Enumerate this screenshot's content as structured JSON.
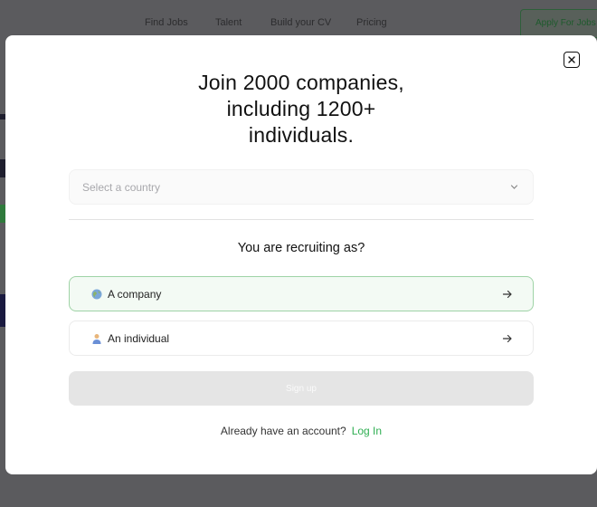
{
  "background_nav": {
    "links": [
      "Find Jobs",
      "Talent",
      "Build your CV",
      "Pricing"
    ],
    "apply_label": "Apply For Jobs"
  },
  "modal": {
    "headline": [
      "Join 2000 companies,",
      "including 1200+",
      "individuals."
    ],
    "country_select": {
      "placeholder": "Select a country",
      "icon": "chevron-down-icon"
    },
    "question": "You are recruiting as?",
    "options": [
      {
        "label": "A company",
        "icon": "globe-icon"
      },
      {
        "label": "An individual",
        "icon": "person-icon"
      }
    ],
    "signup_label": "Sign up",
    "login_prompt": "Already have an account?",
    "login_link": "Log In"
  },
  "colors": {
    "overlay": "#5b5b5e",
    "accent_green": "#2fae52",
    "selected_border": "#9fd3a6",
    "selected_bg": "#f3faf4",
    "disabled_button": "#e5e5e5"
  }
}
